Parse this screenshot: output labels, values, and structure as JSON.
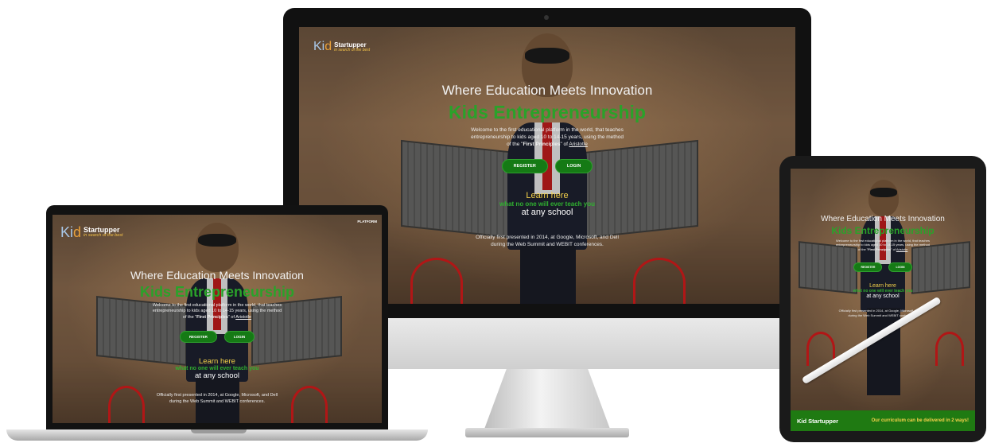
{
  "site": {
    "logo_kid": "Ki",
    "logo_d": "d",
    "logo_name": "Startupper",
    "logo_tag": "in search of the best",
    "nav_platform": "PLATFORM",
    "headline": "Where Education Meets Innovation",
    "brand_title": "Kids Entrepreneurship",
    "welcome_line1": "Welcome to the first educational platform in the world, that teaches",
    "welcome_line2": "entrepreneurship to kids aged 10 to 14-15 years, using the method",
    "welcome_line3_pre": "of the \"",
    "welcome_bold": "First Principles",
    "welcome_line3_mid": "\" of ",
    "welcome_link": "Aristotle",
    "register_label": "REGISTER",
    "login_label": "LOGIN",
    "learn_here": "Learn here",
    "learn_sub": "what no one will ever teach you",
    "at_school": "at any school",
    "presented_line1": "Officially first presented in 2014, at Google, Microsoft, and Dell",
    "presented_line2": "during the Web Summit and WEBIT conferences."
  },
  "tablet_footer": {
    "name": "Kid Startupper",
    "note": "Our curriculum can be delivered in 2 ways!"
  },
  "colors": {
    "brand_green": "#2aa22a",
    "button_green": "#157a15",
    "accent_yellow": "#f4d14a"
  }
}
